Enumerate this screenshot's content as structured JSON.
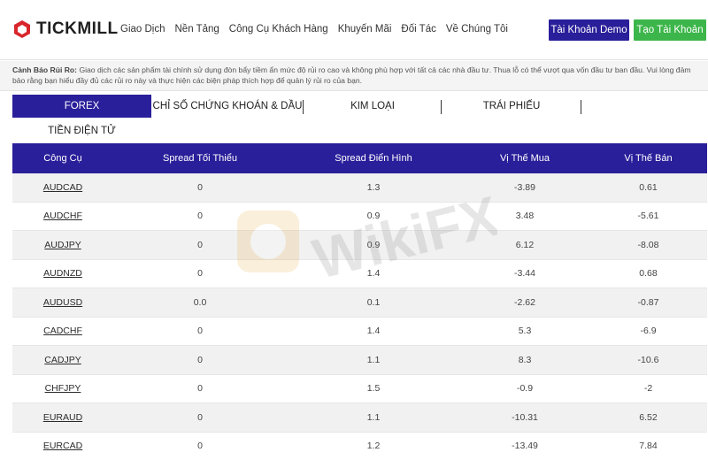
{
  "header": {
    "logo_text": "TICKMILL",
    "nav": [
      "Giao Dịch",
      "Nền Tảng",
      "Công Cụ Khách Hàng",
      "Khuyến Mãi",
      "Đối Tác",
      "Về Chúng Tôi"
    ],
    "demo_button": "Tài Khoản Demo",
    "open_button": "Tạo Tài Khoản"
  },
  "warning": {
    "label": "Cảnh Báo Rủi Ro:",
    "text": "Giao dịch các sản phẩm tài chính sử dụng đòn bẩy tiềm ẩn mức độ rủi ro cao và không phù hợp với tất cả các nhà đầu tư. Thua lỗ có thể vượt qua vốn đầu tư ban đầu. Vui lòng đảm bảo rằng bạn hiểu đầy đủ các rủi ro này và thực hiện các biện pháp thích hợp để quản lý rủi ro của bạn."
  },
  "tabs": [
    "FOREX",
    "CHỈ SỐ CHỨNG KHOÁN & DẦU",
    "KIM LOẠI",
    "TRÁI PHIẾU",
    "TIỀN ĐIỆN TỬ"
  ],
  "table": {
    "headers": [
      "Công Cụ",
      "Spread Tối Thiểu",
      "Spread Điển Hình",
      "Vị Thế Mua",
      "Vị Thế Bán"
    ],
    "rows": [
      [
        "AUDCAD",
        "0",
        "1.3",
        "-3.89",
        "0.61"
      ],
      [
        "AUDCHF",
        "0",
        "0.9",
        "3.48",
        "-5.61"
      ],
      [
        "AUDJPY",
        "0",
        "0.9",
        "6.12",
        "-8.08"
      ],
      [
        "AUDNZD",
        "0",
        "1.4",
        "-3.44",
        "0.68"
      ],
      [
        "AUDUSD",
        "0.0",
        "0.1",
        "-2.62",
        "-0.87"
      ],
      [
        "CADCHF",
        "0",
        "1.4",
        "5.3",
        "-6.9"
      ],
      [
        "CADJPY",
        "0",
        "1.1",
        "8.3",
        "-10.6"
      ],
      [
        "CHFJPY",
        "0",
        "1.5",
        "-0.9",
        "-2"
      ],
      [
        "EURAUD",
        "0",
        "1.1",
        "-10.31",
        "6.52"
      ],
      [
        "EURCAD",
        "0",
        "1.2",
        "-13.49",
        "7.84"
      ]
    ]
  },
  "watermark_text": "WikiFX",
  "colors": {
    "brand_navy": "#2a1f9a",
    "green": "#3cb64a",
    "logo_red": "#d9262c"
  }
}
